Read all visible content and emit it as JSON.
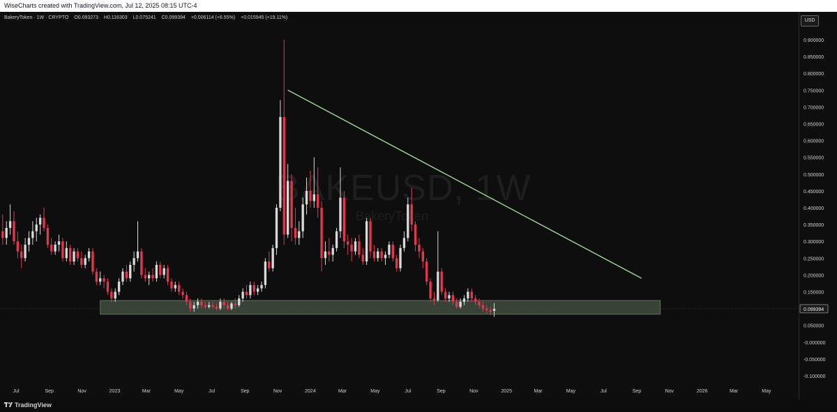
{
  "topbar": {
    "credit": "WiseCharts created with TradingView.com, Jul 12, 2025 08:15 UTC-4"
  },
  "header": {
    "symbol": "BakeryToken · 1W · CRYPTO",
    "open": "O0.093273",
    "high": "H0.116303",
    "low": "L0.075241",
    "close": "C0.099394",
    "change": "+0.006114 (+6.55%)",
    "range": "+0.015945 (+19.11%)"
  },
  "currency_button": "USD",
  "watermark": {
    "main": "BAKEUSD, 1W",
    "sub": "BakeryToken"
  },
  "current_price_label": "0.099394",
  "footer": {
    "brand": "TradingView"
  },
  "colors": {
    "up": "#d9d9d9",
    "down": "#e0394f",
    "trendline": "#a3d69a",
    "support_zone": "#3f4b3d",
    "background": "#0e0e0e"
  },
  "chart_data": {
    "type": "candlestick",
    "title": "BakeryToken · 1W · CRYPTO",
    "ylim": [
      -0.1,
      0.9
    ],
    "y_ticks": [
      "0.900000",
      "0.850000",
      "0.800000",
      "0.750000",
      "0.700000",
      "0.650000",
      "0.600000",
      "0.550000",
      "0.500000",
      "0.450000",
      "0.400000",
      "0.350000",
      "0.300000",
      "0.250000",
      "0.200000",
      "0.150000",
      "0.100000",
      "0.050000",
      "-0.000000",
      "-0.050000",
      "-0.100000"
    ],
    "x_ticks": [
      "Jul",
      "Sep",
      "Nov",
      "2023",
      "Mar",
      "May",
      "Jul",
      "Sep",
      "Nov",
      "2024",
      "Mar",
      "May",
      "Jul",
      "Sep",
      "Nov",
      "2025",
      "Mar",
      "May",
      "Jul",
      "Sep",
      "Nov",
      "2026",
      "Mar",
      "May"
    ],
    "x_range": [
      "2022-06-01",
      "2026-06-30"
    ],
    "ohlc_weekly": [
      [
        0.33,
        0.38,
        0.29,
        0.31
      ],
      [
        0.31,
        0.36,
        0.29,
        0.34
      ],
      [
        0.34,
        0.41,
        0.32,
        0.36
      ],
      [
        0.36,
        0.39,
        0.29,
        0.3
      ],
      [
        0.3,
        0.33,
        0.25,
        0.27
      ],
      [
        0.27,
        0.29,
        0.22,
        0.25
      ],
      [
        0.25,
        0.31,
        0.24,
        0.29
      ],
      [
        0.29,
        0.33,
        0.27,
        0.31
      ],
      [
        0.31,
        0.36,
        0.29,
        0.33
      ],
      [
        0.33,
        0.37,
        0.3,
        0.35
      ],
      [
        0.35,
        0.38,
        0.32,
        0.37
      ],
      [
        0.37,
        0.4,
        0.33,
        0.34
      ],
      [
        0.34,
        0.35,
        0.28,
        0.29
      ],
      [
        0.29,
        0.31,
        0.26,
        0.27
      ],
      [
        0.27,
        0.3,
        0.26,
        0.29
      ],
      [
        0.29,
        0.32,
        0.27,
        0.3
      ],
      [
        0.3,
        0.31,
        0.24,
        0.25
      ],
      [
        0.25,
        0.3,
        0.24,
        0.28
      ],
      [
        0.28,
        0.29,
        0.23,
        0.24
      ],
      [
        0.24,
        0.28,
        0.23,
        0.27
      ],
      [
        0.27,
        0.28,
        0.24,
        0.25
      ],
      [
        0.25,
        0.27,
        0.22,
        0.23
      ],
      [
        0.23,
        0.26,
        0.22,
        0.25
      ],
      [
        0.25,
        0.28,
        0.24,
        0.27
      ],
      [
        0.27,
        0.28,
        0.2,
        0.21
      ],
      [
        0.21,
        0.22,
        0.17,
        0.18
      ],
      [
        0.18,
        0.21,
        0.17,
        0.19
      ],
      [
        0.19,
        0.2,
        0.16,
        0.18
      ],
      [
        0.18,
        0.19,
        0.14,
        0.15
      ],
      [
        0.15,
        0.16,
        0.12,
        0.13
      ],
      [
        0.13,
        0.16,
        0.12,
        0.15
      ],
      [
        0.15,
        0.19,
        0.14,
        0.18
      ],
      [
        0.18,
        0.22,
        0.17,
        0.21
      ],
      [
        0.21,
        0.23,
        0.18,
        0.19
      ],
      [
        0.19,
        0.24,
        0.18,
        0.23
      ],
      [
        0.23,
        0.27,
        0.21,
        0.25
      ],
      [
        0.25,
        0.36,
        0.24,
        0.27
      ],
      [
        0.27,
        0.28,
        0.19,
        0.2
      ],
      [
        0.2,
        0.22,
        0.18,
        0.19
      ],
      [
        0.19,
        0.21,
        0.17,
        0.2
      ],
      [
        0.2,
        0.22,
        0.18,
        0.19
      ],
      [
        0.19,
        0.24,
        0.18,
        0.23
      ],
      [
        0.23,
        0.24,
        0.19,
        0.2
      ],
      [
        0.2,
        0.23,
        0.19,
        0.22
      ],
      [
        0.22,
        0.23,
        0.17,
        0.18
      ],
      [
        0.18,
        0.19,
        0.15,
        0.16
      ],
      [
        0.16,
        0.18,
        0.15,
        0.17
      ],
      [
        0.17,
        0.18,
        0.14,
        0.15
      ],
      [
        0.15,
        0.16,
        0.13,
        0.14
      ],
      [
        0.14,
        0.15,
        0.11,
        0.12
      ],
      [
        0.12,
        0.13,
        0.09,
        0.1
      ],
      [
        0.1,
        0.12,
        0.09,
        0.11
      ],
      [
        0.11,
        0.13,
        0.1,
        0.12
      ],
      [
        0.12,
        0.13,
        0.1,
        0.11
      ],
      [
        0.11,
        0.12,
        0.1,
        0.105
      ],
      [
        0.105,
        0.12,
        0.1,
        0.11
      ],
      [
        0.11,
        0.12,
        0.1,
        0.105
      ],
      [
        0.105,
        0.115,
        0.095,
        0.1
      ],
      [
        0.1,
        0.13,
        0.095,
        0.12
      ],
      [
        0.12,
        0.13,
        0.1,
        0.11
      ],
      [
        0.11,
        0.12,
        0.095,
        0.1
      ],
      [
        0.1,
        0.12,
        0.095,
        0.115
      ],
      [
        0.115,
        0.13,
        0.1,
        0.11
      ],
      [
        0.11,
        0.14,
        0.105,
        0.13
      ],
      [
        0.13,
        0.16,
        0.12,
        0.15
      ],
      [
        0.15,
        0.17,
        0.13,
        0.14
      ],
      [
        0.14,
        0.18,
        0.13,
        0.17
      ],
      [
        0.17,
        0.18,
        0.14,
        0.15
      ],
      [
        0.15,
        0.17,
        0.14,
        0.16
      ],
      [
        0.16,
        0.18,
        0.15,
        0.17
      ],
      [
        0.17,
        0.25,
        0.16,
        0.24
      ],
      [
        0.24,
        0.27,
        0.21,
        0.22
      ],
      [
        0.22,
        0.29,
        0.21,
        0.28
      ],
      [
        0.28,
        0.41,
        0.26,
        0.4
      ],
      [
        0.4,
        0.72,
        0.39,
        0.67
      ],
      [
        0.67,
        0.9,
        0.29,
        0.32
      ],
      [
        0.32,
        0.53,
        0.31,
        0.48
      ],
      [
        0.48,
        0.5,
        0.3,
        0.34
      ],
      [
        0.34,
        0.4,
        0.29,
        0.31
      ],
      [
        0.31,
        0.36,
        0.29,
        0.33
      ],
      [
        0.33,
        0.43,
        0.31,
        0.41
      ],
      [
        0.41,
        0.49,
        0.38,
        0.45
      ],
      [
        0.45,
        0.51,
        0.4,
        0.42
      ],
      [
        0.42,
        0.55,
        0.4,
        0.44
      ],
      [
        0.44,
        0.52,
        0.37,
        0.4
      ],
      [
        0.4,
        0.42,
        0.21,
        0.25
      ],
      [
        0.25,
        0.3,
        0.23,
        0.27
      ],
      [
        0.27,
        0.31,
        0.24,
        0.26
      ],
      [
        0.26,
        0.29,
        0.24,
        0.28
      ],
      [
        0.28,
        0.34,
        0.27,
        0.33
      ],
      [
        0.33,
        0.52,
        0.31,
        0.43
      ],
      [
        0.43,
        0.45,
        0.28,
        0.3
      ],
      [
        0.3,
        0.32,
        0.26,
        0.29
      ],
      [
        0.29,
        0.31,
        0.24,
        0.27
      ],
      [
        0.27,
        0.31,
        0.26,
        0.3
      ],
      [
        0.3,
        0.32,
        0.25,
        0.26
      ],
      [
        0.26,
        0.28,
        0.23,
        0.24
      ],
      [
        0.24,
        0.37,
        0.23,
        0.36
      ],
      [
        0.36,
        0.37,
        0.25,
        0.27
      ],
      [
        0.27,
        0.29,
        0.24,
        0.25
      ],
      [
        0.25,
        0.28,
        0.24,
        0.27
      ],
      [
        0.27,
        0.28,
        0.24,
        0.25
      ],
      [
        0.25,
        0.27,
        0.23,
        0.26
      ],
      [
        0.26,
        0.3,
        0.25,
        0.29
      ],
      [
        0.29,
        0.3,
        0.24,
        0.25
      ],
      [
        0.25,
        0.26,
        0.21,
        0.22
      ],
      [
        0.22,
        0.29,
        0.21,
        0.28
      ],
      [
        0.28,
        0.33,
        0.27,
        0.31
      ],
      [
        0.31,
        0.43,
        0.3,
        0.41
      ],
      [
        0.41,
        0.46,
        0.33,
        0.35
      ],
      [
        0.35,
        0.36,
        0.27,
        0.29
      ],
      [
        0.29,
        0.31,
        0.25,
        0.27
      ],
      [
        0.27,
        0.28,
        0.22,
        0.24
      ],
      [
        0.24,
        0.25,
        0.17,
        0.18
      ],
      [
        0.18,
        0.19,
        0.12,
        0.13
      ],
      [
        0.13,
        0.15,
        0.11,
        0.125
      ],
      [
        0.125,
        0.33,
        0.12,
        0.21
      ],
      [
        0.21,
        0.22,
        0.14,
        0.15
      ],
      [
        0.15,
        0.16,
        0.12,
        0.13
      ],
      [
        0.13,
        0.15,
        0.12,
        0.14
      ],
      [
        0.14,
        0.15,
        0.11,
        0.12
      ],
      [
        0.12,
        0.13,
        0.1,
        0.105
      ],
      [
        0.105,
        0.13,
        0.1,
        0.12
      ],
      [
        0.12,
        0.14,
        0.11,
        0.13
      ],
      [
        0.13,
        0.16,
        0.12,
        0.15
      ],
      [
        0.15,
        0.16,
        0.12,
        0.13
      ],
      [
        0.13,
        0.14,
        0.11,
        0.12
      ],
      [
        0.12,
        0.13,
        0.1,
        0.11
      ],
      [
        0.11,
        0.12,
        0.09,
        0.1
      ],
      [
        0.1,
        0.11,
        0.085,
        0.095
      ],
      [
        0.095,
        0.105,
        0.08,
        0.09
      ],
      [
        0.093273,
        0.116303,
        0.075241,
        0.099394
      ]
    ],
    "trendline": {
      "from": {
        "x": "2023-11-20",
        "y": 0.75
      },
      "to": {
        "x": "2025-09-10",
        "y": 0.19
      }
    },
    "support_zone": {
      "x_start": "2022-12-05",
      "x_end": "2025-10-15",
      "y_low": 0.083,
      "y_high": 0.124
    },
    "last_price": 0.099394
  }
}
